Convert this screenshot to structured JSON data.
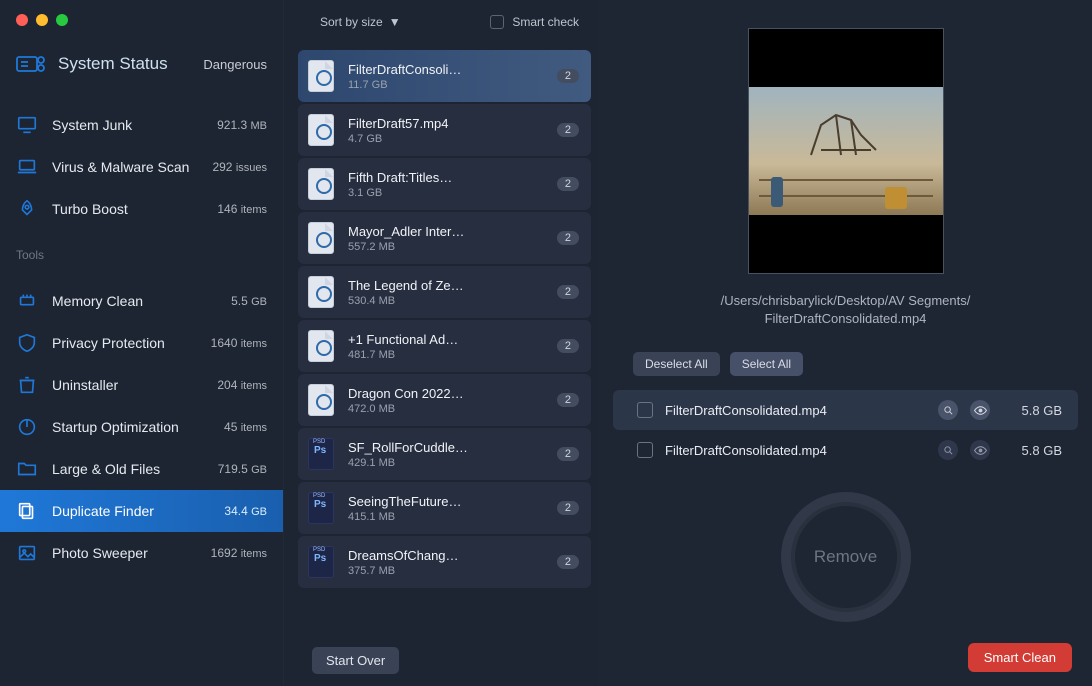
{
  "brand": {
    "title": "System Status",
    "status": "Dangerous"
  },
  "nav": {
    "main": [
      {
        "label": "System Junk",
        "value": "921.3",
        "unit": "MB"
      },
      {
        "label": "Virus & Malware Scan",
        "value": "292",
        "unit": "issues"
      },
      {
        "label": "Turbo Boost",
        "value": "146",
        "unit": "items"
      }
    ],
    "tools_title": "Tools",
    "tools": [
      {
        "label": "Memory Clean",
        "value": "5.5",
        "unit": "GB"
      },
      {
        "label": "Privacy Protection",
        "value": "1640",
        "unit": "items"
      },
      {
        "label": "Uninstaller",
        "value": "204",
        "unit": "items"
      },
      {
        "label": "Startup Optimization",
        "value": "45",
        "unit": "items"
      },
      {
        "label": "Large & Old Files",
        "value": "719.5",
        "unit": "GB"
      },
      {
        "label": "Duplicate Finder",
        "value": "34.4",
        "unit": "GB"
      },
      {
        "label": "Photo Sweeper",
        "value": "1692",
        "unit": "items"
      }
    ]
  },
  "mid": {
    "sort_label": "Sort by size",
    "smart_check_label": "Smart check",
    "start_over": "Start Over",
    "files": [
      {
        "name": "FilterDraftConsoli…",
        "size": "11.7 GB",
        "count": "2",
        "type": "qt"
      },
      {
        "name": "FilterDraft57.mp4",
        "size": "4.7 GB",
        "count": "2",
        "type": "qt"
      },
      {
        "name": "Fifth Draft:Titles…",
        "size": "3.1 GB",
        "count": "2",
        "type": "qt"
      },
      {
        "name": "Mayor_Adler Inter…",
        "size": "557.2 MB",
        "count": "2",
        "type": "qt"
      },
      {
        "name": "The Legend of Ze…",
        "size": "530.4 MB",
        "count": "2",
        "type": "qt"
      },
      {
        "name": "+1 Functional Ad…",
        "size": "481.7 MB",
        "count": "2",
        "type": "qt"
      },
      {
        "name": "Dragon Con 2022…",
        "size": "472.0 MB",
        "count": "2",
        "type": "qt"
      },
      {
        "name": "SF_RollForCuddle…",
        "size": "429.1 MB",
        "count": "2",
        "type": "psd"
      },
      {
        "name": "SeeingTheFuture…",
        "size": "415.1 MB",
        "count": "2",
        "type": "psd"
      },
      {
        "name": "DreamsOfChang…",
        "size": "375.7 MB",
        "count": "2",
        "type": "psd"
      }
    ]
  },
  "right": {
    "path_line1": "/Users/chrisbarylick/Desktop/AV Segments/",
    "path_line2": "FilterDraftConsolidated.mp4",
    "deselect_all": "Deselect All",
    "select_all": "Select All",
    "dups": [
      {
        "name": "FilterDraftConsolidated.mp4",
        "size": "5.8 GB"
      },
      {
        "name": "FilterDraftConsolidated.mp4",
        "size": "5.8 GB"
      }
    ],
    "remove_label": "Remove",
    "smart_clean": "Smart Clean"
  }
}
